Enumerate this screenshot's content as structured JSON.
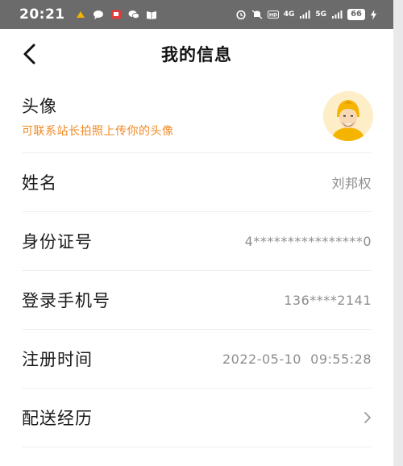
{
  "status_bar": {
    "time": "20:21",
    "net": "4G",
    "net2": "5G",
    "battery": "66"
  },
  "header": {
    "title": "我的信息"
  },
  "avatar_row": {
    "label": "头像",
    "hint": "可联系站长拍照上传你的头像"
  },
  "rows": [
    {
      "label": "姓名",
      "value": "刘邦权"
    },
    {
      "label": "身份证号",
      "value": "4****************0"
    },
    {
      "label": "登录手机号",
      "value": "136****2141"
    },
    {
      "label": "注册时间",
      "value": "2022-05-10  09:55:28"
    },
    {
      "label": "配送经历",
      "value": ""
    }
  ],
  "colors": {
    "accent": "#f08a24",
    "status_bar_bg": "#6b6b6b",
    "avatar_helmet": "#f5b400"
  },
  "icons": {
    "back": "chevron-left-icon",
    "row_arrow": "chevron-right-icon"
  }
}
